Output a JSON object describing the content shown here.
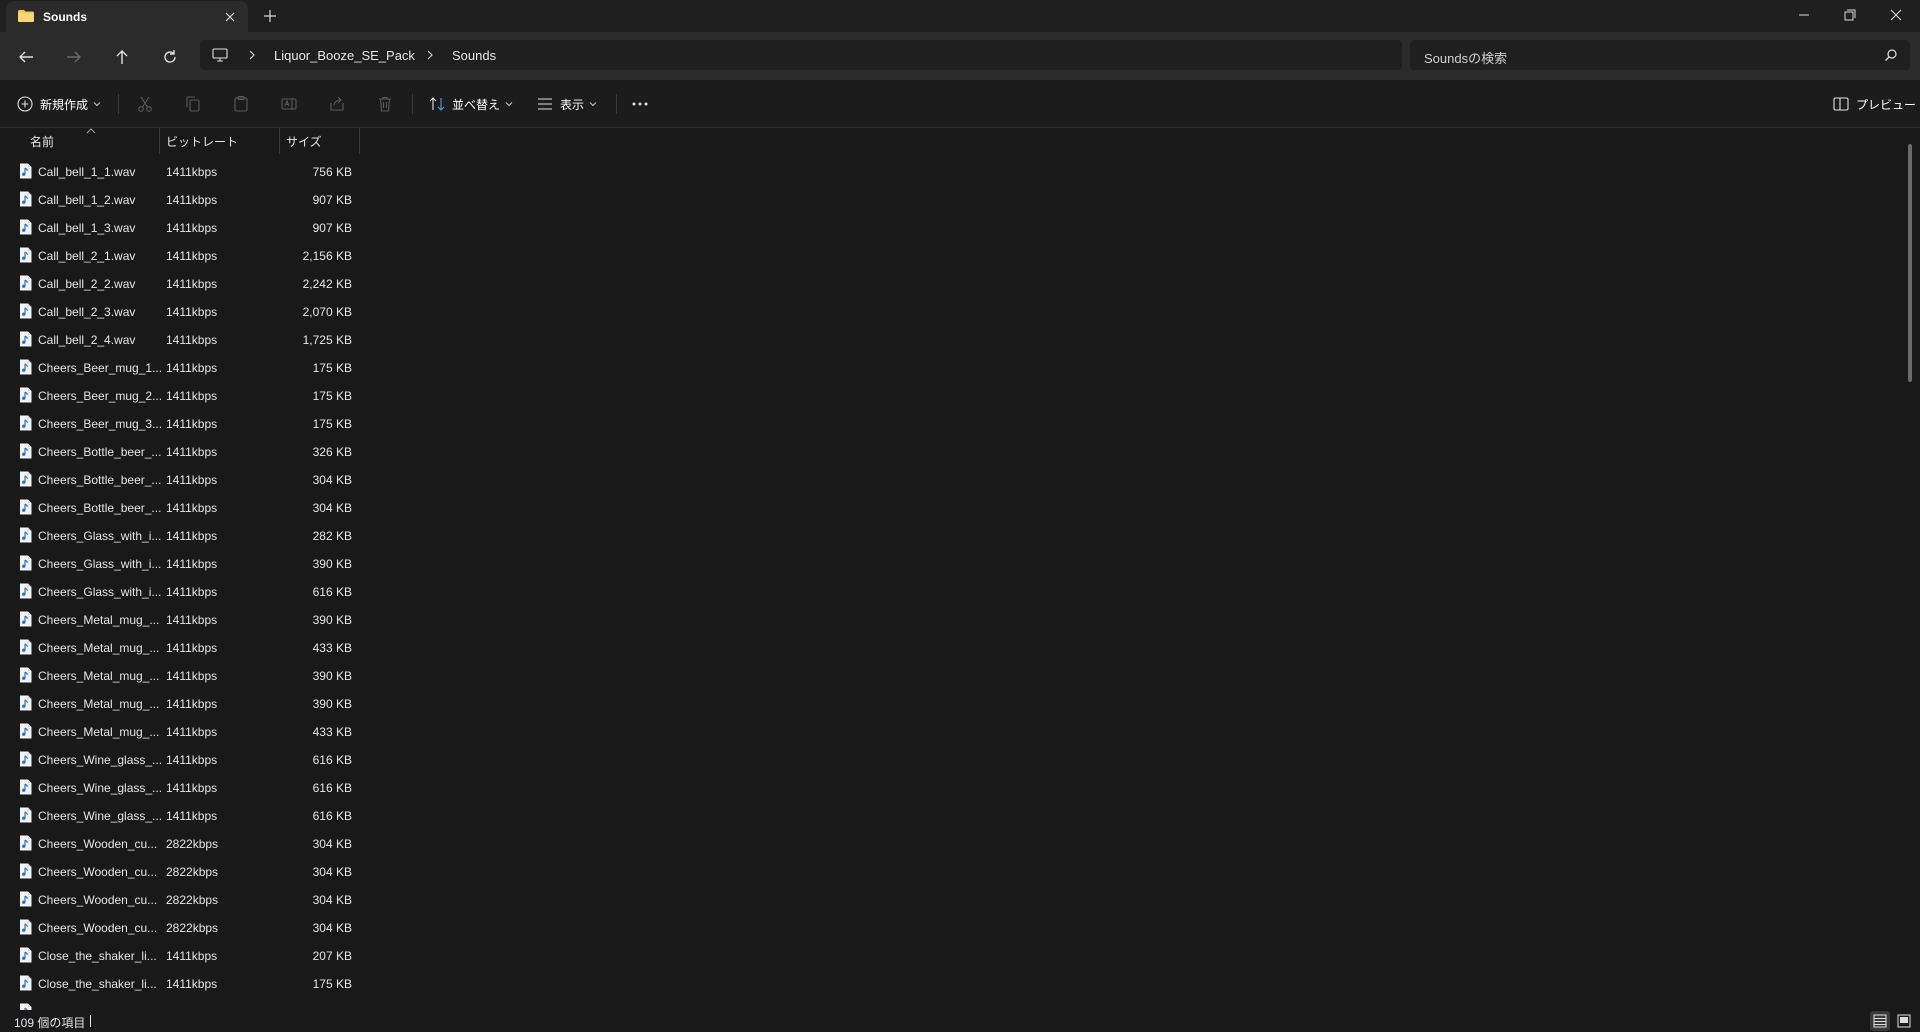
{
  "window": {
    "tab_title": "Sounds",
    "icons": {
      "folder": "folder-icon",
      "close_tab": "close-icon",
      "new_tab": "plus-icon",
      "minimize": "minimize-icon",
      "restore": "restore-icon",
      "close_window": "close-icon"
    }
  },
  "nav": {
    "back": "back-arrow-icon",
    "forward": "forward-arrow-icon",
    "up": "up-arrow-icon",
    "refresh": "refresh-icon",
    "breadcrumbs": [
      "Liquor_Booze_SE_Pack",
      "Sounds"
    ],
    "search_placeholder": "Soundsの検索"
  },
  "toolbar": {
    "new_label": "新規作成",
    "sort_label": "並べ替え",
    "view_label": "表示",
    "preview_label": "プレビュー"
  },
  "columns": {
    "name": "名前",
    "bitrate": "ビットレート",
    "size": "サイズ"
  },
  "files": [
    {
      "name": "Call_bell_1_1.wav",
      "bitrate": "1411kbps",
      "size": "756 KB"
    },
    {
      "name": "Call_bell_1_2.wav",
      "bitrate": "1411kbps",
      "size": "907 KB"
    },
    {
      "name": "Call_bell_1_3.wav",
      "bitrate": "1411kbps",
      "size": "907 KB"
    },
    {
      "name": "Call_bell_2_1.wav",
      "bitrate": "1411kbps",
      "size": "2,156 KB"
    },
    {
      "name": "Call_bell_2_2.wav",
      "bitrate": "1411kbps",
      "size": "2,242 KB"
    },
    {
      "name": "Call_bell_2_3.wav",
      "bitrate": "1411kbps",
      "size": "2,070 KB"
    },
    {
      "name": "Call_bell_2_4.wav",
      "bitrate": "1411kbps",
      "size": "1,725 KB"
    },
    {
      "name": "Cheers_Beer_mug_1...",
      "bitrate": "1411kbps",
      "size": "175 KB"
    },
    {
      "name": "Cheers_Beer_mug_2...",
      "bitrate": "1411kbps",
      "size": "175 KB"
    },
    {
      "name": "Cheers_Beer_mug_3...",
      "bitrate": "1411kbps",
      "size": "175 KB"
    },
    {
      "name": "Cheers_Bottle_beer_...",
      "bitrate": "1411kbps",
      "size": "326 KB"
    },
    {
      "name": "Cheers_Bottle_beer_...",
      "bitrate": "1411kbps",
      "size": "304 KB"
    },
    {
      "name": "Cheers_Bottle_beer_...",
      "bitrate": "1411kbps",
      "size": "304 KB"
    },
    {
      "name": "Cheers_Glass_with_i...",
      "bitrate": "1411kbps",
      "size": "282 KB"
    },
    {
      "name": "Cheers_Glass_with_i...",
      "bitrate": "1411kbps",
      "size": "390 KB"
    },
    {
      "name": "Cheers_Glass_with_i...",
      "bitrate": "1411kbps",
      "size": "616 KB"
    },
    {
      "name": "Cheers_Metal_mug_...",
      "bitrate": "1411kbps",
      "size": "390 KB"
    },
    {
      "name": "Cheers_Metal_mug_...",
      "bitrate": "1411kbps",
      "size": "433 KB"
    },
    {
      "name": "Cheers_Metal_mug_...",
      "bitrate": "1411kbps",
      "size": "390 KB"
    },
    {
      "name": "Cheers_Metal_mug_...",
      "bitrate": "1411kbps",
      "size": "390 KB"
    },
    {
      "name": "Cheers_Metal_mug_...",
      "bitrate": "1411kbps",
      "size": "433 KB"
    },
    {
      "name": "Cheers_Wine_glass_...",
      "bitrate": "1411kbps",
      "size": "616 KB"
    },
    {
      "name": "Cheers_Wine_glass_...",
      "bitrate": "1411kbps",
      "size": "616 KB"
    },
    {
      "name": "Cheers_Wine_glass_...",
      "bitrate": "1411kbps",
      "size": "616 KB"
    },
    {
      "name": "Cheers_Wooden_cu...",
      "bitrate": "2822kbps",
      "size": "304 KB"
    },
    {
      "name": "Cheers_Wooden_cu...",
      "bitrate": "2822kbps",
      "size": "304 KB"
    },
    {
      "name": "Cheers_Wooden_cu...",
      "bitrate": "2822kbps",
      "size": "304 KB"
    },
    {
      "name": "Cheers_Wooden_cu...",
      "bitrate": "2822kbps",
      "size": "304 KB"
    },
    {
      "name": "Close_the_shaker_li...",
      "bitrate": "1411kbps",
      "size": "207 KB"
    },
    {
      "name": "Close_the_shaker_li...",
      "bitrate": "1411kbps",
      "size": "175 KB"
    }
  ],
  "status": {
    "item_count": "109 個の項目"
  },
  "colors": {
    "background": "#191919",
    "toolbar": "#2b2b2b",
    "folder": "#f2c94c",
    "file_icon_accent": "#4a9de0"
  }
}
